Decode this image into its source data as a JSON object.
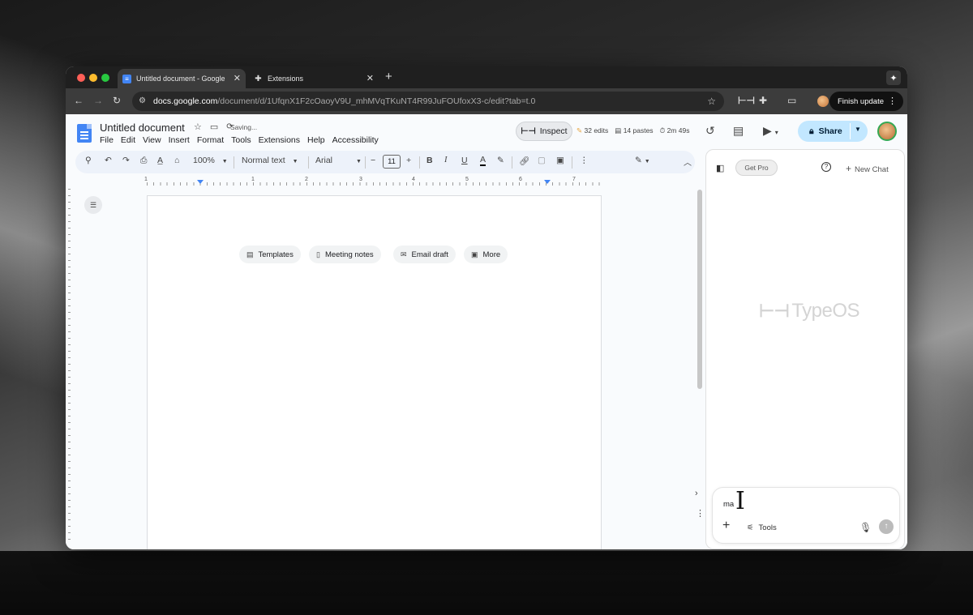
{
  "browser": {
    "tabs": [
      {
        "title": "Untitled document - Google D",
        "active": true
      },
      {
        "title": "Extensions",
        "active": false
      }
    ],
    "new_tab": "+",
    "url_host": "docs.google.com",
    "url_path": "/document/d/1UfqnX1F2cOaoyV9U_mhMVqTKuNT4R99JuFOUfoxX3-c/edit?tab=t.0",
    "finish_update": "Finish update"
  },
  "docs": {
    "title": "Untitled document",
    "saving": "Saving...",
    "menu": [
      "File",
      "Edit",
      "View",
      "Insert",
      "Format",
      "Tools",
      "Extensions",
      "Help",
      "Accessibility"
    ],
    "inspect": "Inspect",
    "stats": {
      "edits": "32 edits",
      "pastes": "14 pastes",
      "time": "2m 49s"
    },
    "share": "Share",
    "toolbar": {
      "zoom": "100%",
      "style": "Normal text",
      "font": "Arial",
      "font_size": "11"
    },
    "ruler_numbers": [
      "1",
      "1",
      "2",
      "3",
      "4",
      "5",
      "6",
      "7"
    ],
    "chips": [
      {
        "label": "Templates",
        "icon": "templates-icon"
      },
      {
        "label": "Meeting notes",
        "icon": "doc-icon"
      },
      {
        "label": "Email draft",
        "icon": "email-icon"
      },
      {
        "label": "More",
        "icon": "more-icon"
      }
    ]
  },
  "panel": {
    "get_pro": "Get Pro",
    "help": "?",
    "new_chat": "New Chat",
    "brand": "TypeOS",
    "composer_value": "ma",
    "tools": "Tools"
  },
  "colors": {
    "share_bg": "#c2e7ff",
    "docs_blue": "#4285f4",
    "toolbar_bg": "#edf2fa"
  }
}
